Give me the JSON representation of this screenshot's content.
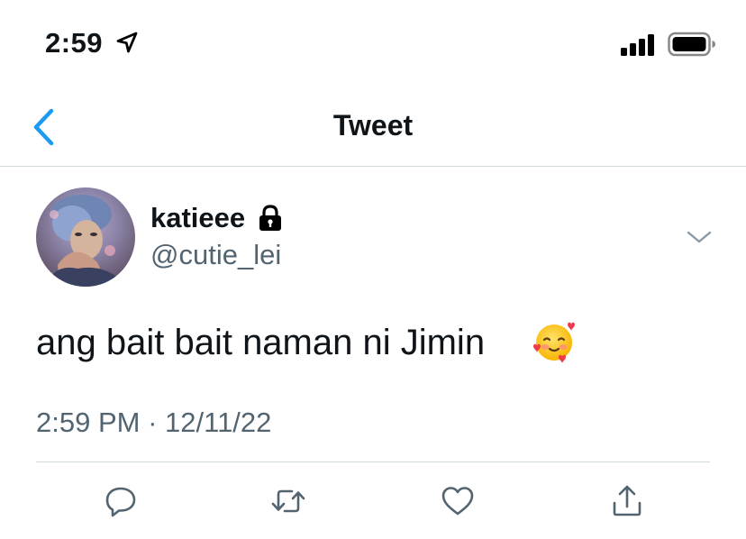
{
  "status_bar": {
    "time": "2:59",
    "icons": [
      "location-arrow-icon",
      "signal-bars-icon",
      "battery-icon"
    ]
  },
  "header": {
    "title": "Tweet",
    "back_icon": "chevron-left-icon"
  },
  "tweet": {
    "author": {
      "display_name": "katieee",
      "handle": "@cutie_lei",
      "protected_icon": "lock-icon",
      "avatar": "avatar"
    },
    "text": "ang bait bait naman ni Jimin",
    "emoji": "smiling-face-with-hearts-emoji",
    "time": "2:59 PM",
    "separator": "·",
    "date": "12/11/22",
    "more_icon": "chevron-down-icon"
  },
  "actions": [
    "reply-icon",
    "retweet-icon",
    "like-icon",
    "share-icon"
  ],
  "colors": {
    "accent": "#1d9bf0",
    "text_primary": "#0f1419",
    "text_secondary": "#536471",
    "divider": "#cfd9de"
  }
}
